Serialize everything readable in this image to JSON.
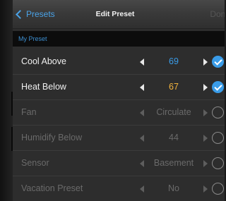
{
  "nav": {
    "back_label": "Presets",
    "title": "Edit Preset",
    "done_label": "Done"
  },
  "preset_name": "My Preset",
  "rows": [
    {
      "label": "Cool Above",
      "value": "69",
      "value_color": "#3a9ce8",
      "enabled": true,
      "checked": true
    },
    {
      "label": "Heat Below",
      "value": "67",
      "value_color": "#f2b33d",
      "enabled": true,
      "checked": true
    },
    {
      "label": "Fan",
      "value": "Circulate",
      "value_color": "#6a6a6a",
      "enabled": false,
      "checked": false
    },
    {
      "label": "Humidify Below",
      "value": "44",
      "value_color": "#6a6a6a",
      "enabled": false,
      "checked": false
    },
    {
      "label": "Sensor",
      "value": "Basement",
      "value_color": "#6a6a6a",
      "enabled": false,
      "checked": false
    },
    {
      "label": "Vacation Preset",
      "value": "No",
      "value_color": "#6a6a6a",
      "enabled": false,
      "checked": false
    }
  ],
  "colors": {
    "accent": "#3a9ce8",
    "heat": "#f2b33d",
    "background": "#2d2d2d"
  }
}
